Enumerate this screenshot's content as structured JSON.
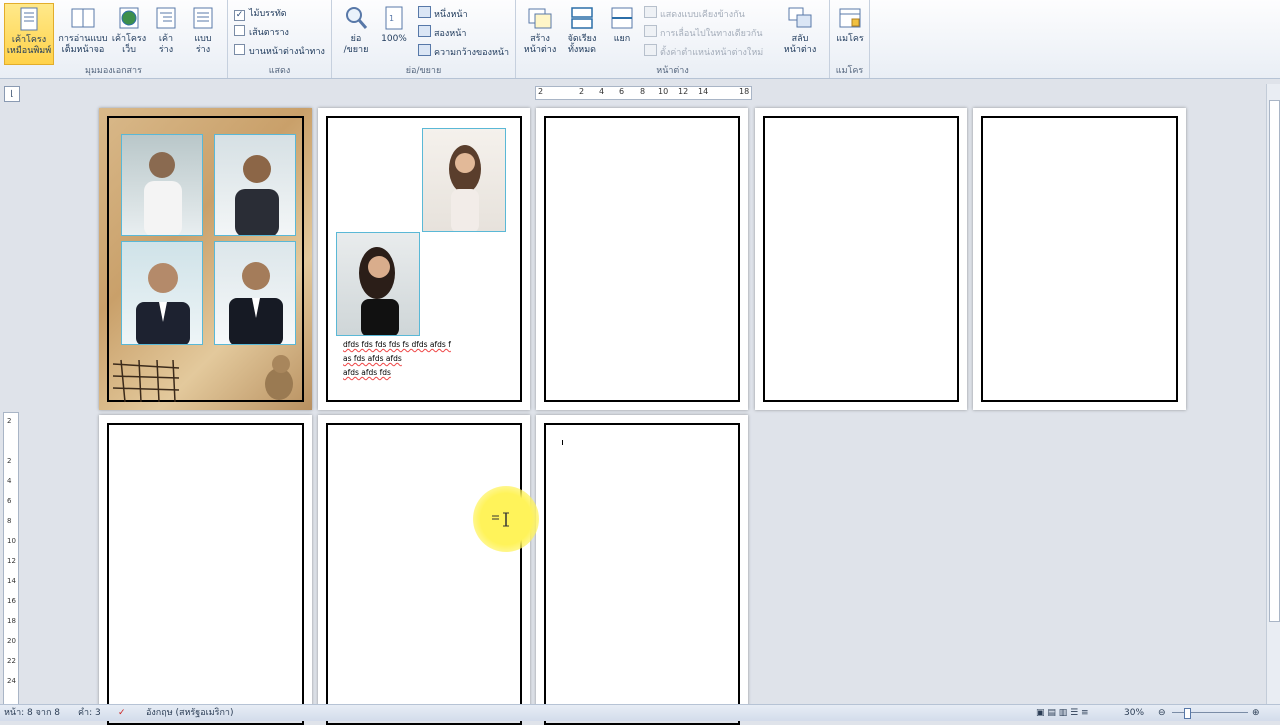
{
  "ribbon": {
    "views_group": {
      "label": "มุมมองเอกสาร",
      "buttons": [
        {
          "line1": "เค้าโครง",
          "line2": "เหมือนพิมพ์",
          "active": true
        },
        {
          "line1": "การอ่านแบบ",
          "line2": "เต็มหน้าจอ"
        },
        {
          "line1": "เค้าโครง",
          "line2": "เว็บ"
        },
        {
          "line1": "เค้า",
          "line2": "ร่าง"
        },
        {
          "line1": "แบบ",
          "line2": "ร่าง"
        }
      ]
    },
    "show_group": {
      "label": "แสดง",
      "ruler": {
        "label": "ไม้บรรทัด",
        "checked": true
      },
      "gridlines": {
        "label": "เส้นตาราง",
        "checked": false
      },
      "navigation": {
        "label": "บานหน้าต่างนำทาง",
        "checked": false
      }
    },
    "zoom_group": {
      "label": "ย่อ/ขยาย",
      "zoom_line1": "ย่อ",
      "zoom_line2": "/ขยาย",
      "percent": "100%",
      "one_page": "หนึ่งหน้า",
      "two_pages": "สองหน้า",
      "page_width": "ความกว้างของหน้า"
    },
    "window_group": {
      "label": "หน้าต่าง",
      "new_window_line1": "สร้าง",
      "new_window_line2": "หน้าต่าง",
      "arrange_line1": "จัดเรียง",
      "arrange_line2": "ทั้งหมด",
      "split": "แยก",
      "side_by_side": "แสดงแบบเคียงข้างกัน",
      "sync_scroll": "การเลื่อนไปในทางเดียวกัน",
      "reset_position": "ตั้งค่าตำแหน่งหน้าต่างใหม่",
      "switch_line1": "สลับ",
      "switch_line2": "หน้าต่าง"
    },
    "macros_group": {
      "label": "แมโคร",
      "button": "แมโคร"
    }
  },
  "ruler": {
    "marks": [
      "2",
      "2",
      "4",
      "6",
      "8",
      "10",
      "12",
      "14",
      "18"
    ],
    "vertical_marks": [
      "2",
      "2",
      "4",
      "6",
      "8",
      "10",
      "12",
      "14",
      "16",
      "18",
      "20",
      "22",
      "24"
    ]
  },
  "document": {
    "text_lines": [
      "dfds fds fds fds fs dfds afds f",
      "as fds afds afds",
      "afds afds fds"
    ]
  },
  "status": {
    "page": "หน้า: 8 จาก 8",
    "words": "คำ: 3",
    "language": "อังกฤษ (สหรัฐอเมริกา)",
    "zoom": "30%"
  },
  "colors": {
    "active_button": "#ffd24a",
    "highlight": "#fff35a",
    "photo_border": "#5ab8d6",
    "page_background": "#dfe3ea"
  }
}
